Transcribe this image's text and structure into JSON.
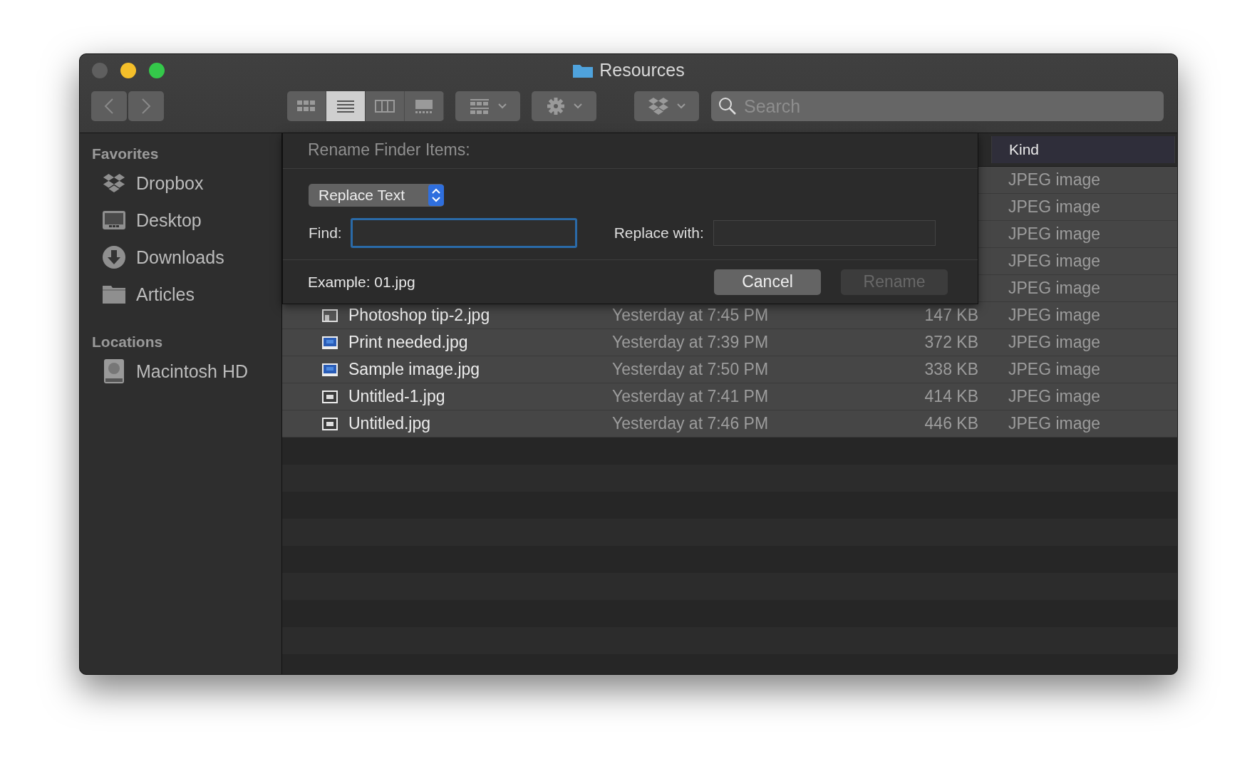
{
  "window": {
    "title": "Resources",
    "controls": [
      {
        "color": "#5f5f5f"
      },
      {
        "color": "#f4bf2a"
      },
      {
        "color": "#34c84a"
      }
    ]
  },
  "toolbar": {
    "view_modes": [
      {
        "kind": "icons",
        "selected": false
      },
      {
        "kind": "list",
        "selected": true
      },
      {
        "kind": "columns",
        "selected": false
      },
      {
        "kind": "gallery",
        "selected": false
      }
    ],
    "search": {
      "placeholder": "Search"
    }
  },
  "sidebar": {
    "sections": [
      {
        "heading": "Favorites",
        "items": [
          {
            "label": "Dropbox",
            "kind": "dropbox"
          },
          {
            "label": "Desktop",
            "kind": "desktop"
          },
          {
            "label": "Downloads",
            "kind": "downloads"
          },
          {
            "label": "Articles",
            "kind": "folder"
          }
        ]
      },
      {
        "heading": "Locations",
        "items": [
          {
            "label": "Macintosh HD",
            "kind": "disk"
          }
        ]
      }
    ]
  },
  "file_list": {
    "columns": [
      {
        "label": "Kind",
        "selected": true
      }
    ],
    "rows": [
      {
        "file_kind": "JPEG image"
      },
      {
        "file_kind": "JPEG image"
      },
      {
        "file_kind": "JPEG image"
      },
      {
        "file_kind": "JPEG image"
      },
      {
        "file_kind": "JPEG image"
      },
      {
        "kind": "gray",
        "name": "Photoshop tip-2.jpg",
        "date": "Yesterday at 7:45 PM",
        "size": "147 KB",
        "file_kind": "JPEG image"
      },
      {
        "kind": "blue",
        "name": "Print needed.jpg",
        "date": "Yesterday at 7:39 PM",
        "size": "372 KB",
        "file_kind": "JPEG image"
      },
      {
        "kind": "blue",
        "name": "Sample image.jpg",
        "date": "Yesterday at 7:50 PM",
        "size": "338 KB",
        "file_kind": "JPEG image"
      },
      {
        "kind": "outline",
        "name": "Untitled-1.jpg",
        "date": "Yesterday at 7:41 PM",
        "size": "414 KB",
        "file_kind": "JPEG image"
      },
      {
        "kind": "outline",
        "name": "Untitled.jpg",
        "date": "Yesterday at 7:46 PM",
        "size": "446 KB",
        "file_kind": "JPEG image"
      }
    ]
  },
  "dialog": {
    "title": "Rename Finder Items:",
    "mode": "Replace Text",
    "fields": [
      {
        "label": "Find:",
        "focused": true
      },
      {
        "label": "Replace with:",
        "focused": false
      }
    ],
    "example": "Example: 01.jpg",
    "buttons": [
      {
        "label": "Cancel",
        "disabled": false
      },
      {
        "label": "Rename",
        "disabled": true
      }
    ]
  }
}
